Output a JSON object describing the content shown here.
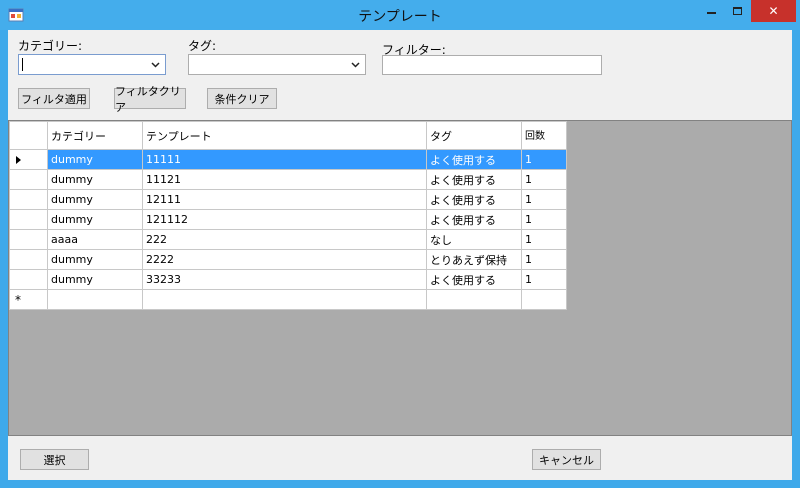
{
  "window": {
    "title": "テンプレート",
    "close_glyph": "✕"
  },
  "filters": {
    "category_label": "カテゴリー:",
    "tag_label": "タグ:",
    "filter_label": "フィルター:",
    "category_value": "",
    "tag_value": "",
    "filter_value": ""
  },
  "buttons": {
    "apply_filter": "フィルタ適用",
    "clear_filter": "フィルタクリア",
    "clear_conditions": "条件クリア",
    "select": "選択",
    "cancel": "キャンセル"
  },
  "grid": {
    "columns": [
      "カテゴリー",
      "テンプレート",
      "タグ",
      "回数"
    ],
    "new_row_marker": "*",
    "rows": [
      {
        "category": "dummy",
        "template": "11111",
        "tag": "よく使用する",
        "count": "1",
        "selected": true
      },
      {
        "category": "dummy",
        "template": "11121",
        "tag": "よく使用する",
        "count": "1"
      },
      {
        "category": "dummy",
        "template": "12111",
        "tag": "よく使用する",
        "count": "1"
      },
      {
        "category": "dummy",
        "template": "121112",
        "tag": "よく使用する",
        "count": "1"
      },
      {
        "category": "aaaa",
        "template": "222",
        "tag": "なし",
        "count": "1"
      },
      {
        "category": "dummy",
        "template": "2222",
        "tag": "とりあえず保持",
        "count": "1"
      },
      {
        "category": "dummy",
        "template": "33233",
        "tag": "よく使用する",
        "count": "1"
      }
    ]
  }
}
